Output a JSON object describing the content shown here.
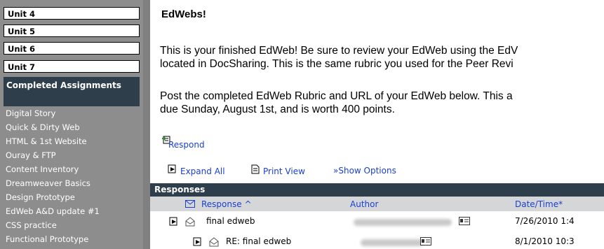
{
  "sidebar": {
    "units": [
      "Unit 4",
      "Unit 5",
      "Unit 6",
      "Unit 7"
    ],
    "completed_header": "Completed Assignments",
    "assignments": [
      "Digital Story",
      "Quick & Dirty Web",
      "HTML & 1st Website",
      "Ouray & FTP",
      "Content Inventory",
      "Dreamweaver Basics",
      "Design Prototype",
      "EdWeb A&D update #1",
      "CSS practice",
      "Functional Prototype"
    ]
  },
  "main": {
    "title": "EdWebs!",
    "para1_line1": "This is your finished EdWeb!  Be sure to review your EdWeb using the EdV",
    "para1_line2": "located in DocSharing.  This is the same rubric you used for the Peer Revi",
    "para2_line1": "Post the completed EdWeb Rubric and URL of your EdWeb below.  This a",
    "para2_line2": "due Sunday, August 1st, and is worth 400 points.",
    "respond_label": "Respond",
    "toolbar": {
      "expand_all": "Expand All",
      "print_view": "Print View",
      "show_options": "»Show Options"
    },
    "responses_title": "Responses",
    "columns": {
      "response": "Response ^",
      "author": "Author",
      "datetime": "Date/Time*"
    },
    "rows": [
      {
        "response": "final edweb",
        "datetime": "7/26/2010 1:4"
      },
      {
        "response": "RE: final edweb",
        "datetime": "8/1/2010 10:3"
      }
    ]
  }
}
